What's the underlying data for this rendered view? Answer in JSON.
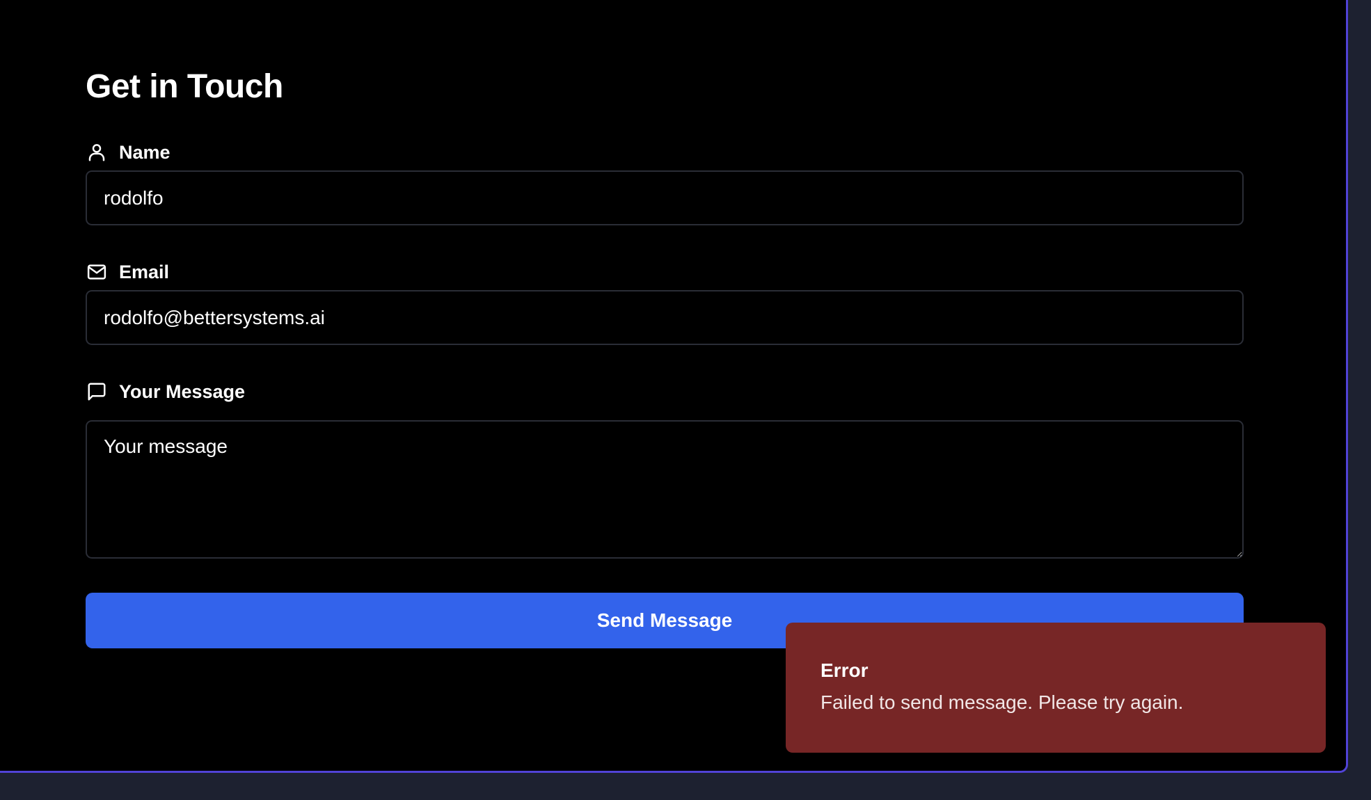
{
  "page": {
    "title": "Get in Touch"
  },
  "form": {
    "name": {
      "label": "Name",
      "icon": "user-icon",
      "value": "rodolfo"
    },
    "email": {
      "label": "Email",
      "icon": "mail-icon",
      "value": "rodolfo@bettersystems.ai"
    },
    "message": {
      "label": "Your Message",
      "icon": "message-square-icon",
      "value": "",
      "placeholder": "Your message"
    },
    "submit_label": "Send Message"
  },
  "toast": {
    "title": "Error",
    "message": "Failed to send message. Please try again."
  },
  "colors": {
    "background": "#000000",
    "frame_border": "#5143d6",
    "button": "#3363eb",
    "toast_error": "#772626",
    "input_border": "#2a2d36"
  }
}
